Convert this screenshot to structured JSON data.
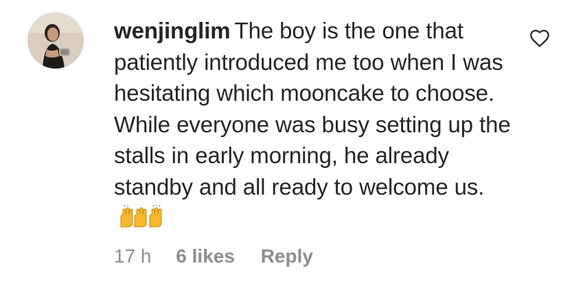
{
  "comment": {
    "username": "wenjinglim",
    "text": "The boy is the one that patiently introduced me too when I was hesitating which mooncake to choose. While everyone was busy setting up the stalls in early morning, he already standby and all ready to welcome us.",
    "emoji": "raising-hands-emoji",
    "timestamp": "17 h",
    "likes_label": "6 likes",
    "reply_label": "Reply",
    "like_icon": "heart-outline-icon"
  },
  "colors": {
    "text": "#262626",
    "secondary": "#8e8e8e",
    "emoji": "#f5b82e"
  }
}
